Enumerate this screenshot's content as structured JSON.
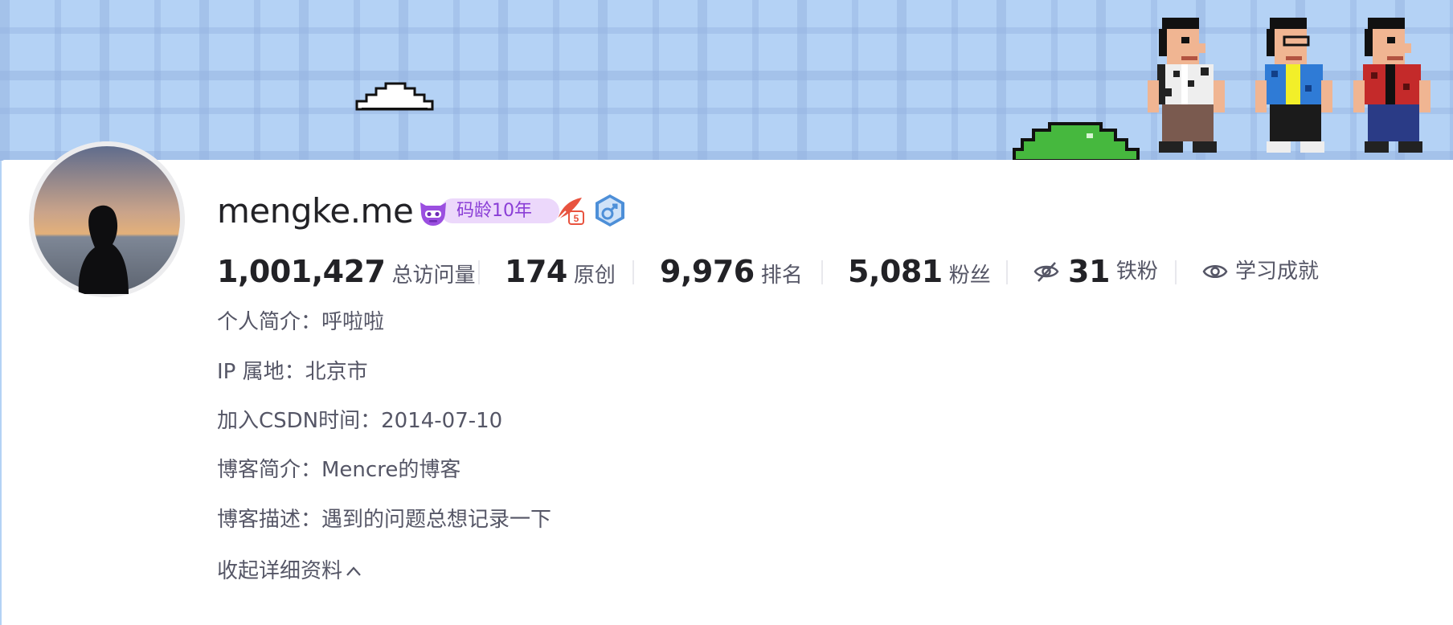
{
  "profile": {
    "name": "mengke.me",
    "badge_label": "码龄10年"
  },
  "stats": [
    {
      "value": "1,001,427",
      "label": "总访问量"
    },
    {
      "value": "174",
      "label": "原创"
    },
    {
      "value": "9,976",
      "label": "排名"
    },
    {
      "value": "5,081",
      "label": "粉丝"
    },
    {
      "value": "31",
      "label": "铁粉"
    }
  ],
  "achievements_label": "学习成就",
  "info": {
    "intro": "个人简介：呼啦啦",
    "ip": "IP 属地：北京市",
    "joined": "加入CSDN时间：2014-07-10",
    "blog_intro": "博客简介：Mencre的博客",
    "blog_desc": "博客描述：遇到的问题总想记录一下",
    "collapse_label": "收起详细资料"
  },
  "icons": {
    "badge": "devil-face-icon",
    "writer": "quill-writer-icon",
    "gender": "male-icon",
    "iron_fans": "eye-slash-icon",
    "achievements": "eye-icon",
    "collapse": "chevron-up-icon"
  },
  "colors": {
    "banner": "#b4d2f5",
    "badge_bg": "#ecd8fb",
    "badge_text": "#8a3ed6",
    "male_badge": "#4d8fd8",
    "writer_badge": "#e8533f"
  }
}
